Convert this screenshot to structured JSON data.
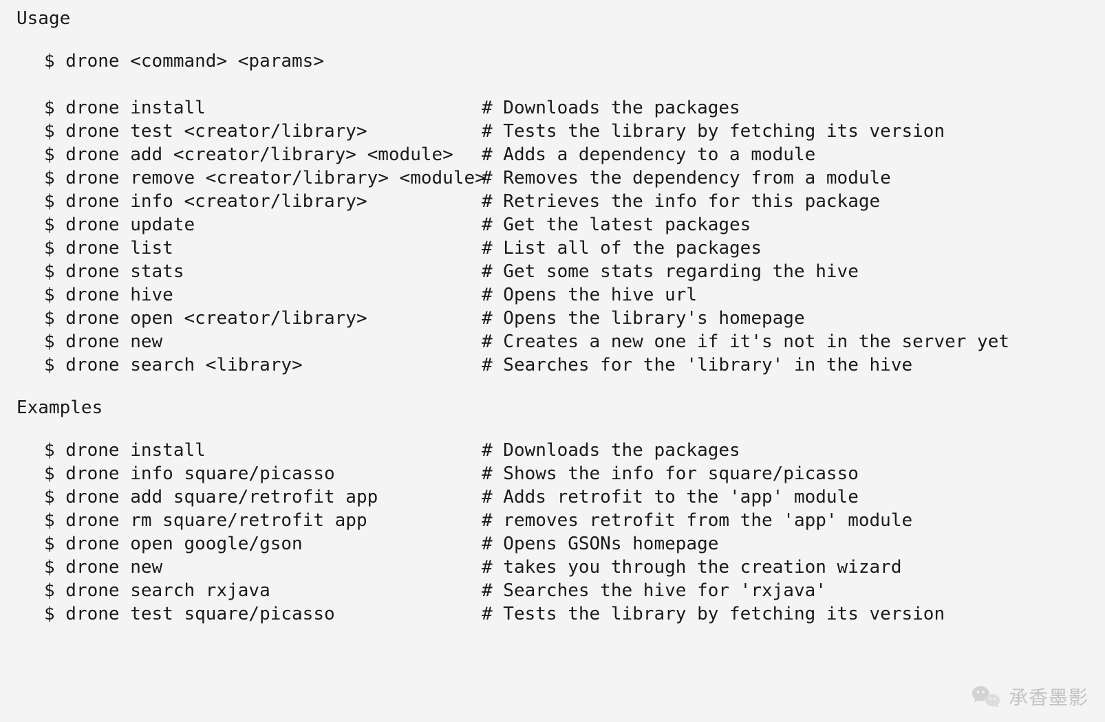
{
  "headings": {
    "usage": "Usage",
    "examples": "Examples"
  },
  "usage_intro": "$ drone <command> <params>",
  "usage": [
    {
      "cmd": "$ drone install",
      "cmt": "# Downloads the packages"
    },
    {
      "cmd": "$ drone test <creator/library>",
      "cmt": "# Tests the library by fetching its version"
    },
    {
      "cmd": "$ drone add <creator/library> <module>",
      "cmt": "# Adds a dependency to a module"
    },
    {
      "cmd": "$ drone remove <creator/library> <module>",
      "cmt": "# Removes the dependency from a module"
    },
    {
      "cmd": "$ drone info <creator/library>",
      "cmt": "# Retrieves the info for this package"
    },
    {
      "cmd": "$ drone update",
      "cmt": "# Get the latest packages"
    },
    {
      "cmd": "$ drone list",
      "cmt": "# List all of the packages"
    },
    {
      "cmd": "$ drone stats",
      "cmt": "# Get some stats regarding the hive"
    },
    {
      "cmd": "$ drone hive",
      "cmt": "# Opens the hive url"
    },
    {
      "cmd": "$ drone open <creator/library>",
      "cmt": "# Opens the library's homepage"
    },
    {
      "cmd": "$ drone new",
      "cmt": "# Creates a new one if it's not in the server yet"
    },
    {
      "cmd": "$ drone search <library>",
      "cmt": "# Searches for the 'library' in the hive"
    }
  ],
  "examples": [
    {
      "cmd": "$ drone install",
      "cmt": "# Downloads the packages"
    },
    {
      "cmd": "$ drone info square/picasso",
      "cmt": "# Shows the info for square/picasso"
    },
    {
      "cmd": "$ drone add square/retrofit app",
      "cmt": "# Adds retrofit to the 'app' module"
    },
    {
      "cmd": "$ drone rm square/retrofit app",
      "cmt": "# removes retrofit from the 'app' module"
    },
    {
      "cmd": "$ drone open google/gson",
      "cmt": "# Opens GSONs homepage"
    },
    {
      "cmd": "$ drone new",
      "cmt": "# takes you through the creation wizard"
    },
    {
      "cmd": "$ drone search rxjava",
      "cmt": "# Searches the hive for 'rxjava'"
    },
    {
      "cmd": "$ drone test square/picasso",
      "cmt": "# Tests the library by fetching its version"
    }
  ],
  "watermark": "承香墨影"
}
